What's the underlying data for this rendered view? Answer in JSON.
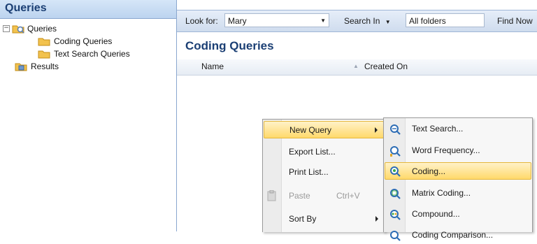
{
  "nav": {
    "title": "Queries",
    "tree": {
      "root_label": "Queries",
      "children": [
        "Coding Queries",
        "Text Search Queries"
      ],
      "results_label": "Results"
    }
  },
  "toolbar": {
    "look_for_label": "Look for:",
    "look_for_value": "Mary",
    "search_in_label": "Search In",
    "folder_value": "All folders",
    "find_now_label": "Find Now"
  },
  "content": {
    "title": "Coding Queries",
    "columns": [
      "Name",
      "Created On"
    ]
  },
  "context_menu": {
    "items": [
      {
        "label": "New Query",
        "highlighted": true,
        "has_submenu": true
      },
      {
        "label": "Export List...",
        "enabled": true
      },
      {
        "label": "Print List...",
        "enabled": true
      },
      {
        "label": "Paste",
        "shortcut": "Ctrl+V",
        "enabled": false
      },
      {
        "label": "Sort By",
        "has_submenu": true
      }
    ]
  },
  "submenu": {
    "items": [
      {
        "label": "Text Search...",
        "icon": "text-search-query-icon"
      },
      {
        "label": "Word Frequency...",
        "icon": "word-frequency-query-icon"
      },
      {
        "label": "Coding...",
        "icon": "coding-query-icon",
        "highlighted": true
      },
      {
        "label": "Matrix Coding...",
        "icon": "matrix-coding-query-icon"
      },
      {
        "label": "Compound...",
        "icon": "compound-query-icon"
      },
      {
        "label": "Coding Comparison...",
        "icon": "coding-comparison-query-icon"
      }
    ]
  },
  "colors": {
    "header_text": "#1b3f74",
    "highlight": "#ffd96b",
    "folder": "#f2c24e"
  }
}
